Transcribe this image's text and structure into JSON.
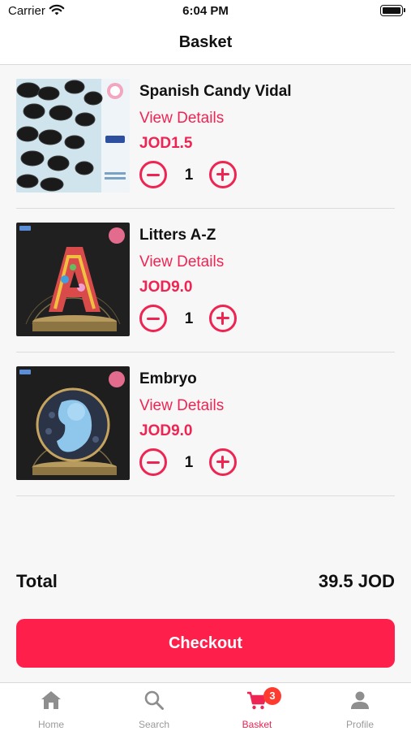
{
  "status_bar": {
    "carrier": "Carrier",
    "time": "6:04 PM"
  },
  "header": {
    "title": "Basket"
  },
  "basket": {
    "items": [
      {
        "name": "Spanish Candy Vidal",
        "details_label": "View Details",
        "price": "JOD1.5",
        "quantity": "1"
      },
      {
        "name": "Litters A-Z",
        "details_label": "View Details",
        "price": "JOD9.0",
        "quantity": "1"
      },
      {
        "name": "Embryo",
        "details_label": "View Details",
        "price": "JOD9.0",
        "quantity": "1"
      }
    ]
  },
  "summary": {
    "total_label": "Total",
    "total_value": "39.5 JOD"
  },
  "checkout": {
    "label": "Checkout"
  },
  "tabbar": {
    "tabs": [
      {
        "label": "Home",
        "icon": "home-icon"
      },
      {
        "label": "Search",
        "icon": "search-icon"
      },
      {
        "label": "Basket",
        "icon": "cart-icon",
        "badge": "3"
      },
      {
        "label": "Profile",
        "icon": "person-icon"
      }
    ]
  },
  "colors": {
    "accent": "#ee2453",
    "checkout": "#ff1f4b",
    "badge": "#ff3b30",
    "inactive_tab": "#9a9a9a"
  }
}
